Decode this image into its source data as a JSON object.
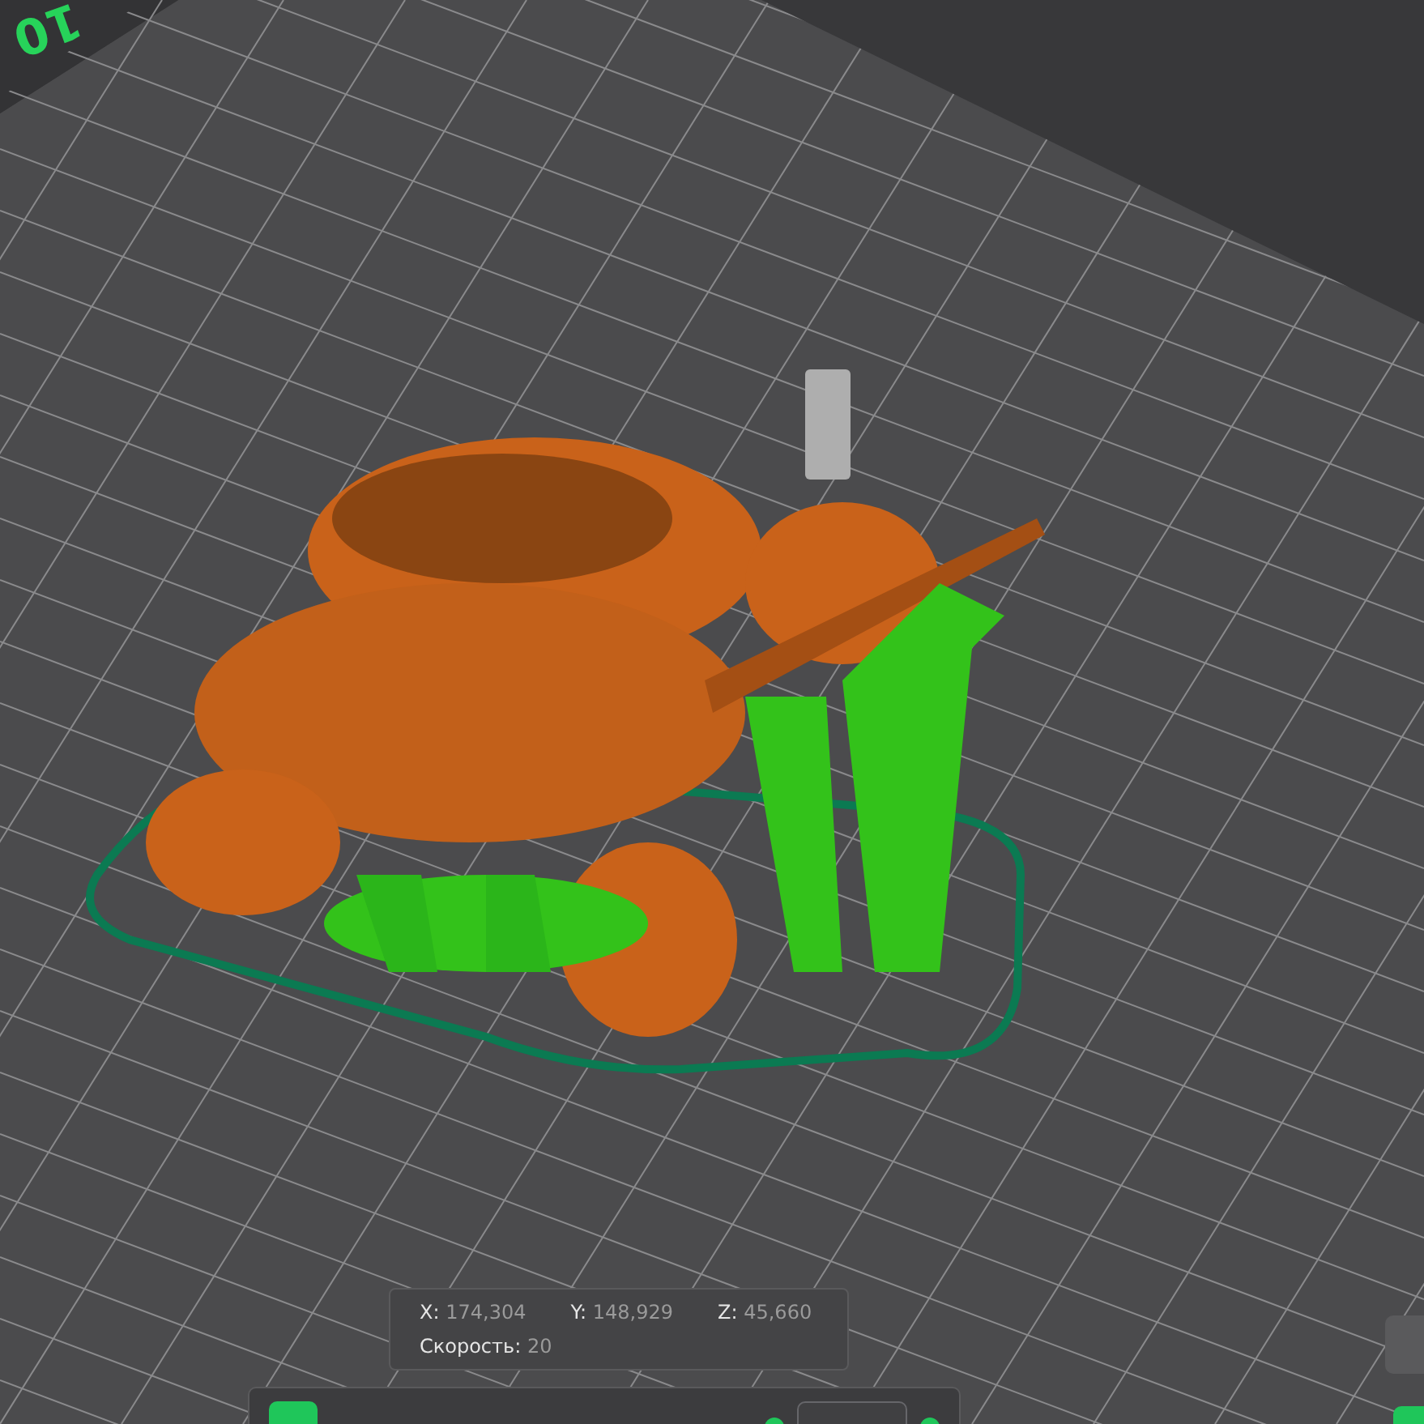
{
  "viewport": {
    "bed_label": "10"
  },
  "position_panel": {
    "coordinates": [
      {
        "axis": "X:",
        "value": "174,304"
      },
      {
        "axis": "Y:",
        "value": "148,929"
      },
      {
        "axis": "Z:",
        "value": "45,660"
      }
    ],
    "speed": {
      "label": "Скорость:",
      "value": "20"
    }
  }
}
